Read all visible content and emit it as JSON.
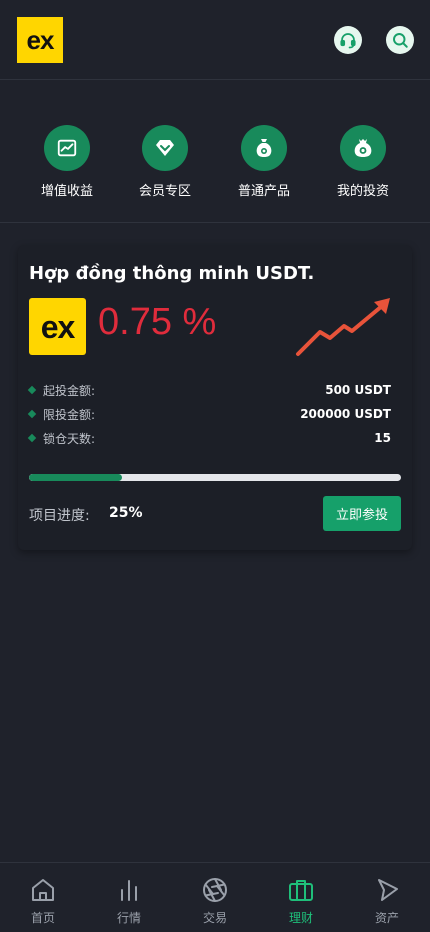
{
  "header": {
    "logo_text": "ex",
    "icons": [
      "headset-icon",
      "search-icon"
    ]
  },
  "categories": [
    {
      "label": "增值收益",
      "icon": "chart-line-icon"
    },
    {
      "label": "会员专区",
      "icon": "diamond-icon"
    },
    {
      "label": "普通产品",
      "icon": "money-bag-icon"
    },
    {
      "label": "我的投资",
      "icon": "money-bag-coin-icon"
    }
  ],
  "product": {
    "title": "Hợp đồng thông minh USDT.",
    "logo_text": "ex",
    "rate": "0.75 %",
    "details": [
      {
        "label": "起投金额:",
        "value": "500 USDT"
      },
      {
        "label": "限投金额:",
        "value": "200000 USDT"
      },
      {
        "label": "锁仓天数:",
        "value": "15"
      }
    ],
    "progress_label": "项目进度:",
    "progress_value": "25%",
    "progress_fraction": 0.25,
    "invest_label": "立即参投"
  },
  "colors": {
    "accent": "#188a5b",
    "rate": "#e02c3c",
    "brand": "#ffd600",
    "active_tab": "#1fbf7a"
  },
  "tabbar": {
    "active": "理财",
    "items": [
      {
        "label": "首页",
        "icon": "home-icon"
      },
      {
        "label": "行情",
        "icon": "bar-chart-icon"
      },
      {
        "label": "交易",
        "icon": "aperture-icon"
      },
      {
        "label": "理财",
        "icon": "briefcase-icon"
      },
      {
        "label": "资产",
        "icon": "play-icon"
      }
    ]
  }
}
